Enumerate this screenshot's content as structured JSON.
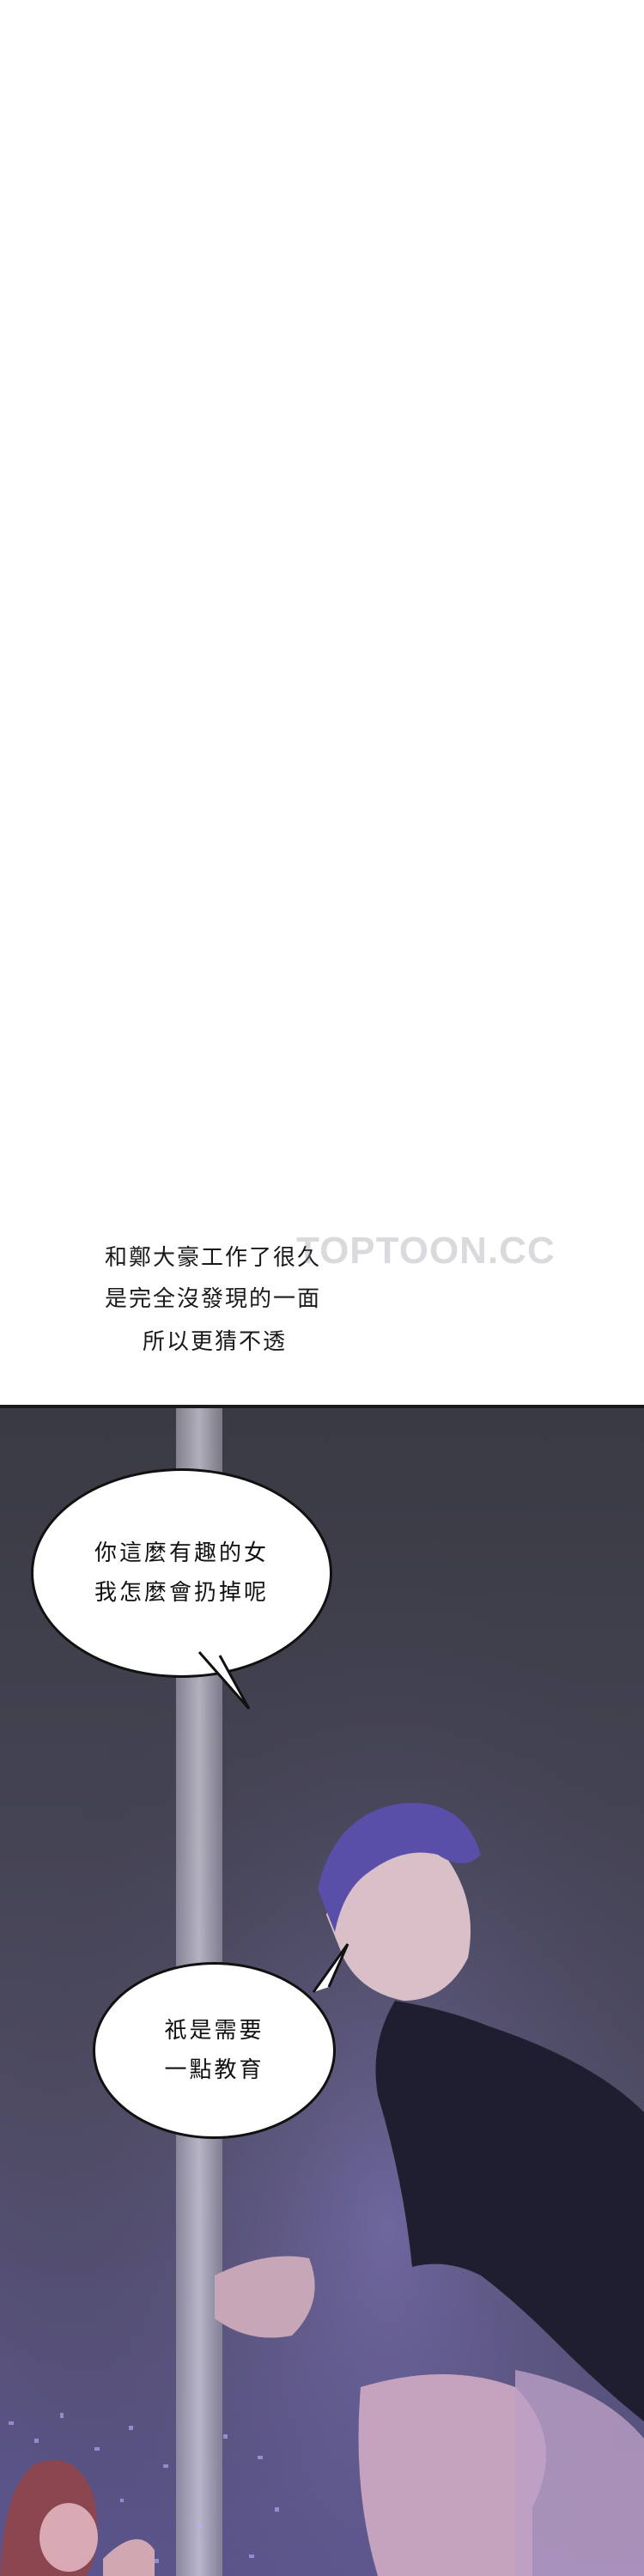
{
  "narration": {
    "lines": [
      "和鄭大豪工作了很久",
      "是完全沒發現的一面",
      "所以更猜不透"
    ]
  },
  "watermark": "TOPTOON.CC",
  "bubbles": [
    {
      "lines": [
        "你這麼有趣的女",
        "我怎麼會扔掉呢"
      ]
    },
    {
      "lines": [
        "祇是需要",
        "一點教育"
      ]
    }
  ],
  "colors": {
    "night_sky": "#3a3a44",
    "city_glow": "#5c5590",
    "suit": "#1e1e30",
    "hair": "#5a4fa8"
  }
}
